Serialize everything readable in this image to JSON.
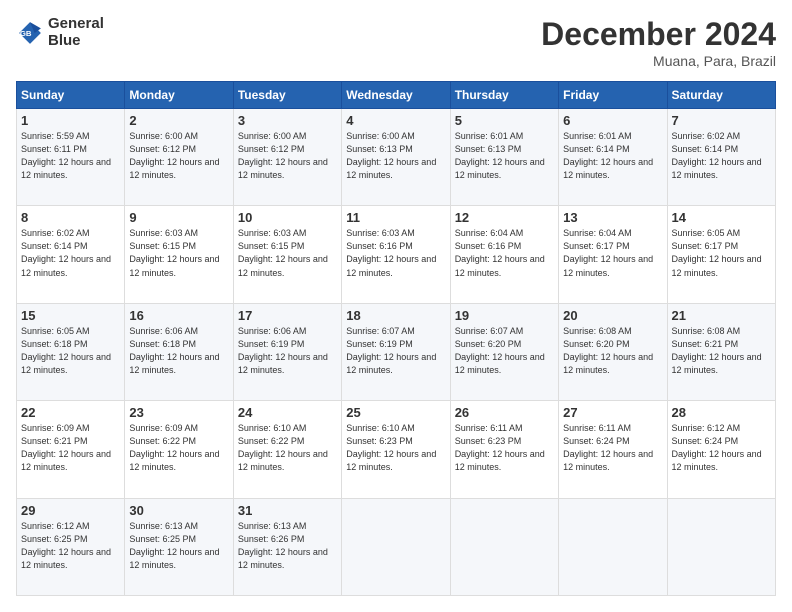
{
  "header": {
    "logo_line1": "General",
    "logo_line2": "Blue",
    "month": "December 2024",
    "location": "Muana, Para, Brazil"
  },
  "weekdays": [
    "Sunday",
    "Monday",
    "Tuesday",
    "Wednesday",
    "Thursday",
    "Friday",
    "Saturday"
  ],
  "weeks": [
    [
      {
        "day": "1",
        "sunrise": "Sunrise: 5:59 AM",
        "sunset": "Sunset: 6:11 PM",
        "daylight": "Daylight: 12 hours and 12 minutes."
      },
      {
        "day": "2",
        "sunrise": "Sunrise: 6:00 AM",
        "sunset": "Sunset: 6:12 PM",
        "daylight": "Daylight: 12 hours and 12 minutes."
      },
      {
        "day": "3",
        "sunrise": "Sunrise: 6:00 AM",
        "sunset": "Sunset: 6:12 PM",
        "daylight": "Daylight: 12 hours and 12 minutes."
      },
      {
        "day": "4",
        "sunrise": "Sunrise: 6:00 AM",
        "sunset": "Sunset: 6:13 PM",
        "daylight": "Daylight: 12 hours and 12 minutes."
      },
      {
        "day": "5",
        "sunrise": "Sunrise: 6:01 AM",
        "sunset": "Sunset: 6:13 PM",
        "daylight": "Daylight: 12 hours and 12 minutes."
      },
      {
        "day": "6",
        "sunrise": "Sunrise: 6:01 AM",
        "sunset": "Sunset: 6:14 PM",
        "daylight": "Daylight: 12 hours and 12 minutes."
      },
      {
        "day": "7",
        "sunrise": "Sunrise: 6:02 AM",
        "sunset": "Sunset: 6:14 PM",
        "daylight": "Daylight: 12 hours and 12 minutes."
      }
    ],
    [
      {
        "day": "8",
        "sunrise": "Sunrise: 6:02 AM",
        "sunset": "Sunset: 6:14 PM",
        "daylight": "Daylight: 12 hours and 12 minutes."
      },
      {
        "day": "9",
        "sunrise": "Sunrise: 6:03 AM",
        "sunset": "Sunset: 6:15 PM",
        "daylight": "Daylight: 12 hours and 12 minutes."
      },
      {
        "day": "10",
        "sunrise": "Sunrise: 6:03 AM",
        "sunset": "Sunset: 6:15 PM",
        "daylight": "Daylight: 12 hours and 12 minutes."
      },
      {
        "day": "11",
        "sunrise": "Sunrise: 6:03 AM",
        "sunset": "Sunset: 6:16 PM",
        "daylight": "Daylight: 12 hours and 12 minutes."
      },
      {
        "day": "12",
        "sunrise": "Sunrise: 6:04 AM",
        "sunset": "Sunset: 6:16 PM",
        "daylight": "Daylight: 12 hours and 12 minutes."
      },
      {
        "day": "13",
        "sunrise": "Sunrise: 6:04 AM",
        "sunset": "Sunset: 6:17 PM",
        "daylight": "Daylight: 12 hours and 12 minutes."
      },
      {
        "day": "14",
        "sunrise": "Sunrise: 6:05 AM",
        "sunset": "Sunset: 6:17 PM",
        "daylight": "Daylight: 12 hours and 12 minutes."
      }
    ],
    [
      {
        "day": "15",
        "sunrise": "Sunrise: 6:05 AM",
        "sunset": "Sunset: 6:18 PM",
        "daylight": "Daylight: 12 hours and 12 minutes."
      },
      {
        "day": "16",
        "sunrise": "Sunrise: 6:06 AM",
        "sunset": "Sunset: 6:18 PM",
        "daylight": "Daylight: 12 hours and 12 minutes."
      },
      {
        "day": "17",
        "sunrise": "Sunrise: 6:06 AM",
        "sunset": "Sunset: 6:19 PM",
        "daylight": "Daylight: 12 hours and 12 minutes."
      },
      {
        "day": "18",
        "sunrise": "Sunrise: 6:07 AM",
        "sunset": "Sunset: 6:19 PM",
        "daylight": "Daylight: 12 hours and 12 minutes."
      },
      {
        "day": "19",
        "sunrise": "Sunrise: 6:07 AM",
        "sunset": "Sunset: 6:20 PM",
        "daylight": "Daylight: 12 hours and 12 minutes."
      },
      {
        "day": "20",
        "sunrise": "Sunrise: 6:08 AM",
        "sunset": "Sunset: 6:20 PM",
        "daylight": "Daylight: 12 hours and 12 minutes."
      },
      {
        "day": "21",
        "sunrise": "Sunrise: 6:08 AM",
        "sunset": "Sunset: 6:21 PM",
        "daylight": "Daylight: 12 hours and 12 minutes."
      }
    ],
    [
      {
        "day": "22",
        "sunrise": "Sunrise: 6:09 AM",
        "sunset": "Sunset: 6:21 PM",
        "daylight": "Daylight: 12 hours and 12 minutes."
      },
      {
        "day": "23",
        "sunrise": "Sunrise: 6:09 AM",
        "sunset": "Sunset: 6:22 PM",
        "daylight": "Daylight: 12 hours and 12 minutes."
      },
      {
        "day": "24",
        "sunrise": "Sunrise: 6:10 AM",
        "sunset": "Sunset: 6:22 PM",
        "daylight": "Daylight: 12 hours and 12 minutes."
      },
      {
        "day": "25",
        "sunrise": "Sunrise: 6:10 AM",
        "sunset": "Sunset: 6:23 PM",
        "daylight": "Daylight: 12 hours and 12 minutes."
      },
      {
        "day": "26",
        "sunrise": "Sunrise: 6:11 AM",
        "sunset": "Sunset: 6:23 PM",
        "daylight": "Daylight: 12 hours and 12 minutes."
      },
      {
        "day": "27",
        "sunrise": "Sunrise: 6:11 AM",
        "sunset": "Sunset: 6:24 PM",
        "daylight": "Daylight: 12 hours and 12 minutes."
      },
      {
        "day": "28",
        "sunrise": "Sunrise: 6:12 AM",
        "sunset": "Sunset: 6:24 PM",
        "daylight": "Daylight: 12 hours and 12 minutes."
      }
    ],
    [
      {
        "day": "29",
        "sunrise": "Sunrise: 6:12 AM",
        "sunset": "Sunset: 6:25 PM",
        "daylight": "Daylight: 12 hours and 12 minutes."
      },
      {
        "day": "30",
        "sunrise": "Sunrise: 6:13 AM",
        "sunset": "Sunset: 6:25 PM",
        "daylight": "Daylight: 12 hours and 12 minutes."
      },
      {
        "day": "31",
        "sunrise": "Sunrise: 6:13 AM",
        "sunset": "Sunset: 6:26 PM",
        "daylight": "Daylight: 12 hours and 12 minutes."
      },
      null,
      null,
      null,
      null
    ]
  ]
}
